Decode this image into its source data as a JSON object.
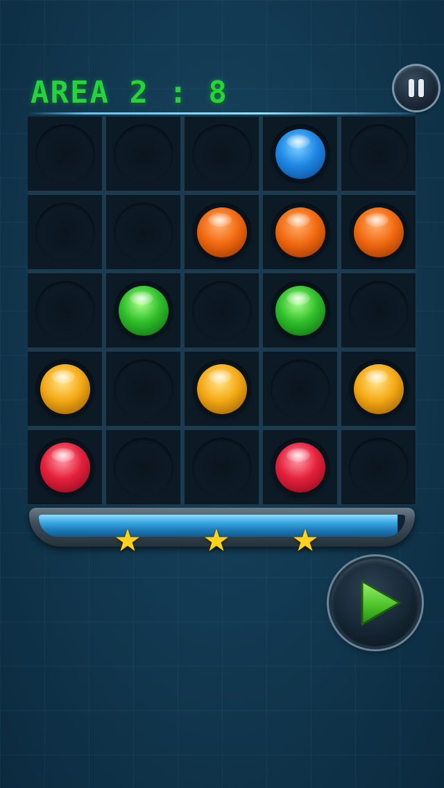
{
  "header": {
    "area_label": "AREA 2 : 8"
  },
  "icons": {
    "pause": "pause-icon",
    "play": "play-icon",
    "star": "star-icon"
  },
  "colors": {
    "blue": "#1e88e5",
    "orange": "#f26a10",
    "green": "#2fbf2a",
    "yellow": "#f5a915",
    "red": "#e5213c",
    "title_green": "#25d43a",
    "play_green": "#5fd23a"
  },
  "board": {
    "rows": 5,
    "cols": 5,
    "grid": [
      [
        null,
        null,
        null,
        "blue",
        null
      ],
      [
        null,
        null,
        "orange",
        "orange",
        "orange"
      ],
      [
        null,
        "green",
        null,
        "green",
        null
      ],
      [
        "yellow",
        null,
        "yellow",
        null,
        "yellow"
      ],
      [
        "red",
        null,
        null,
        "red",
        null
      ]
    ]
  },
  "progress": {
    "fill_fraction": 0.98,
    "stars": 3
  }
}
